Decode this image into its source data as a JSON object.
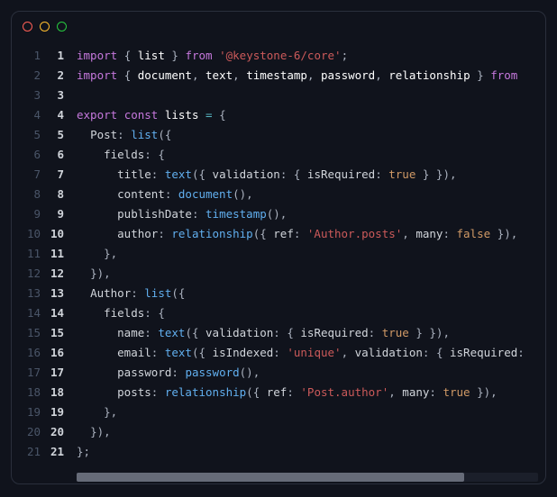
{
  "window": {
    "buttons": [
      "close",
      "minimize",
      "zoom"
    ]
  },
  "code": {
    "line_count": 21,
    "lines": [
      [
        {
          "t": "import",
          "c": "kw"
        },
        {
          "t": " ",
          "c": "pn"
        },
        {
          "t": "{",
          "c": "pn"
        },
        {
          "t": " ",
          "c": "pn"
        },
        {
          "t": "list",
          "c": "wt"
        },
        {
          "t": " ",
          "c": "pn"
        },
        {
          "t": "}",
          "c": "pn"
        },
        {
          "t": " ",
          "c": "pn"
        },
        {
          "t": "from",
          "c": "kw"
        },
        {
          "t": " ",
          "c": "pn"
        },
        {
          "t": "'@keystone-6/core'",
          "c": "str"
        },
        {
          "t": ";",
          "c": "pn"
        }
      ],
      [
        {
          "t": "import",
          "c": "kw"
        },
        {
          "t": " ",
          "c": "pn"
        },
        {
          "t": "{",
          "c": "pn"
        },
        {
          "t": " ",
          "c": "pn"
        },
        {
          "t": "document",
          "c": "wt"
        },
        {
          "t": ",",
          "c": "pn"
        },
        {
          "t": " ",
          "c": "pn"
        },
        {
          "t": "text",
          "c": "wt"
        },
        {
          "t": ",",
          "c": "pn"
        },
        {
          "t": " ",
          "c": "pn"
        },
        {
          "t": "timestamp",
          "c": "wt"
        },
        {
          "t": ",",
          "c": "pn"
        },
        {
          "t": " ",
          "c": "pn"
        },
        {
          "t": "password",
          "c": "wt"
        },
        {
          "t": ",",
          "c": "pn"
        },
        {
          "t": " ",
          "c": "pn"
        },
        {
          "t": "relationship",
          "c": "wt"
        },
        {
          "t": " ",
          "c": "pn"
        },
        {
          "t": "}",
          "c": "pn"
        },
        {
          "t": " ",
          "c": "pn"
        },
        {
          "t": "from",
          "c": "kw"
        }
      ],
      [],
      [
        {
          "t": "export",
          "c": "kw"
        },
        {
          "t": " ",
          "c": "pn"
        },
        {
          "t": "const",
          "c": "kw"
        },
        {
          "t": " ",
          "c": "pn"
        },
        {
          "t": "lists",
          "c": "wt"
        },
        {
          "t": " ",
          "c": "pn"
        },
        {
          "t": "=",
          "c": "blue"
        },
        {
          "t": " ",
          "c": "pn"
        },
        {
          "t": "{",
          "c": "pn"
        }
      ],
      [
        {
          "t": "  ",
          "c": "pn"
        },
        {
          "t": "Post",
          "c": "fld"
        },
        {
          "t": ":",
          "c": "pn"
        },
        {
          "t": " ",
          "c": "pn"
        },
        {
          "t": "list",
          "c": "fn"
        },
        {
          "t": "({",
          "c": "pn"
        }
      ],
      [
        {
          "t": "    ",
          "c": "pn"
        },
        {
          "t": "fields",
          "c": "fld"
        },
        {
          "t": ":",
          "c": "pn"
        },
        {
          "t": " ",
          "c": "pn"
        },
        {
          "t": "{",
          "c": "pn"
        }
      ],
      [
        {
          "t": "      ",
          "c": "pn"
        },
        {
          "t": "title",
          "c": "fld"
        },
        {
          "t": ":",
          "c": "pn"
        },
        {
          "t": " ",
          "c": "pn"
        },
        {
          "t": "text",
          "c": "fn"
        },
        {
          "t": "({ ",
          "c": "pn"
        },
        {
          "t": "validation",
          "c": "fld"
        },
        {
          "t": ":",
          "c": "pn"
        },
        {
          "t": " { ",
          "c": "pn"
        },
        {
          "t": "isRequired",
          "c": "fld"
        },
        {
          "t": ":",
          "c": "pn"
        },
        {
          "t": " ",
          "c": "pn"
        },
        {
          "t": "true",
          "c": "bool"
        },
        {
          "t": " } }),",
          "c": "pn"
        }
      ],
      [
        {
          "t": "      ",
          "c": "pn"
        },
        {
          "t": "content",
          "c": "fld"
        },
        {
          "t": ":",
          "c": "pn"
        },
        {
          "t": " ",
          "c": "pn"
        },
        {
          "t": "document",
          "c": "fn"
        },
        {
          "t": "(),",
          "c": "pn"
        }
      ],
      [
        {
          "t": "      ",
          "c": "pn"
        },
        {
          "t": "publishDate",
          "c": "fld"
        },
        {
          "t": ":",
          "c": "pn"
        },
        {
          "t": " ",
          "c": "pn"
        },
        {
          "t": "timestamp",
          "c": "fn"
        },
        {
          "t": "(),",
          "c": "pn"
        }
      ],
      [
        {
          "t": "      ",
          "c": "pn"
        },
        {
          "t": "author",
          "c": "fld"
        },
        {
          "t": ":",
          "c": "pn"
        },
        {
          "t": " ",
          "c": "pn"
        },
        {
          "t": "relationship",
          "c": "fn"
        },
        {
          "t": "({ ",
          "c": "pn"
        },
        {
          "t": "ref",
          "c": "fld"
        },
        {
          "t": ":",
          "c": "pn"
        },
        {
          "t": " ",
          "c": "pn"
        },
        {
          "t": "'Author.posts'",
          "c": "str"
        },
        {
          "t": ",",
          "c": "pn"
        },
        {
          "t": " ",
          "c": "pn"
        },
        {
          "t": "many",
          "c": "fld"
        },
        {
          "t": ":",
          "c": "pn"
        },
        {
          "t": " ",
          "c": "pn"
        },
        {
          "t": "false",
          "c": "bool"
        },
        {
          "t": " }),",
          "c": "pn"
        }
      ],
      [
        {
          "t": "    ",
          "c": "pn"
        },
        {
          "t": "},",
          "c": "pn"
        }
      ],
      [
        {
          "t": "  ",
          "c": "pn"
        },
        {
          "t": "}),",
          "c": "pn"
        }
      ],
      [
        {
          "t": "  ",
          "c": "pn"
        },
        {
          "t": "Author",
          "c": "fld"
        },
        {
          "t": ":",
          "c": "pn"
        },
        {
          "t": " ",
          "c": "pn"
        },
        {
          "t": "list",
          "c": "fn"
        },
        {
          "t": "({",
          "c": "pn"
        }
      ],
      [
        {
          "t": "    ",
          "c": "pn"
        },
        {
          "t": "fields",
          "c": "fld"
        },
        {
          "t": ":",
          "c": "pn"
        },
        {
          "t": " ",
          "c": "pn"
        },
        {
          "t": "{",
          "c": "pn"
        }
      ],
      [
        {
          "t": "      ",
          "c": "pn"
        },
        {
          "t": "name",
          "c": "fld"
        },
        {
          "t": ":",
          "c": "pn"
        },
        {
          "t": " ",
          "c": "pn"
        },
        {
          "t": "text",
          "c": "fn"
        },
        {
          "t": "({ ",
          "c": "pn"
        },
        {
          "t": "validation",
          "c": "fld"
        },
        {
          "t": ":",
          "c": "pn"
        },
        {
          "t": " { ",
          "c": "pn"
        },
        {
          "t": "isRequired",
          "c": "fld"
        },
        {
          "t": ":",
          "c": "pn"
        },
        {
          "t": " ",
          "c": "pn"
        },
        {
          "t": "true",
          "c": "bool"
        },
        {
          "t": " } }),",
          "c": "pn"
        }
      ],
      [
        {
          "t": "      ",
          "c": "pn"
        },
        {
          "t": "email",
          "c": "fld"
        },
        {
          "t": ":",
          "c": "pn"
        },
        {
          "t": " ",
          "c": "pn"
        },
        {
          "t": "text",
          "c": "fn"
        },
        {
          "t": "({ ",
          "c": "pn"
        },
        {
          "t": "isIndexed",
          "c": "fld"
        },
        {
          "t": ":",
          "c": "pn"
        },
        {
          "t": " ",
          "c": "pn"
        },
        {
          "t": "'unique'",
          "c": "str"
        },
        {
          "t": ",",
          "c": "pn"
        },
        {
          "t": " ",
          "c": "pn"
        },
        {
          "t": "validation",
          "c": "fld"
        },
        {
          "t": ":",
          "c": "pn"
        },
        {
          "t": " { ",
          "c": "pn"
        },
        {
          "t": "isRequired",
          "c": "fld"
        },
        {
          "t": ":",
          "c": "pn"
        }
      ],
      [
        {
          "t": "      ",
          "c": "pn"
        },
        {
          "t": "password",
          "c": "fld"
        },
        {
          "t": ":",
          "c": "pn"
        },
        {
          "t": " ",
          "c": "pn"
        },
        {
          "t": "password",
          "c": "fn"
        },
        {
          "t": "(),",
          "c": "pn"
        }
      ],
      [
        {
          "t": "      ",
          "c": "pn"
        },
        {
          "t": "posts",
          "c": "fld"
        },
        {
          "t": ":",
          "c": "pn"
        },
        {
          "t": " ",
          "c": "pn"
        },
        {
          "t": "relationship",
          "c": "fn"
        },
        {
          "t": "({ ",
          "c": "pn"
        },
        {
          "t": "ref",
          "c": "fld"
        },
        {
          "t": ":",
          "c": "pn"
        },
        {
          "t": " ",
          "c": "pn"
        },
        {
          "t": "'Post.author'",
          "c": "str"
        },
        {
          "t": ",",
          "c": "pn"
        },
        {
          "t": " ",
          "c": "pn"
        },
        {
          "t": "many",
          "c": "fld"
        },
        {
          "t": ":",
          "c": "pn"
        },
        {
          "t": " ",
          "c": "pn"
        },
        {
          "t": "true",
          "c": "bool"
        },
        {
          "t": " }),",
          "c": "pn"
        }
      ],
      [
        {
          "t": "    ",
          "c": "pn"
        },
        {
          "t": "},",
          "c": "pn"
        }
      ],
      [
        {
          "t": "  ",
          "c": "pn"
        },
        {
          "t": "}),",
          "c": "pn"
        }
      ],
      [
        {
          "t": "};",
          "c": "pn"
        }
      ]
    ]
  },
  "scrollbar": {
    "thumb_percent": 84
  }
}
